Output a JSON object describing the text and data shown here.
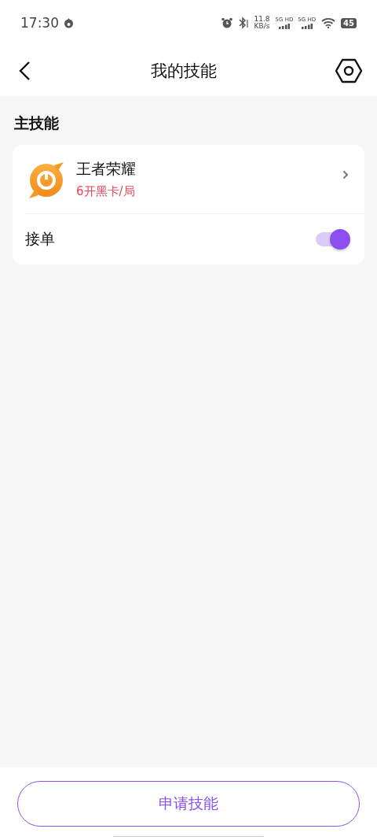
{
  "status_bar": {
    "time": "17:30",
    "speed": "11.8",
    "speed_unit": "KB/s",
    "networks": [
      "5G HD",
      "5G HD"
    ],
    "battery": "45"
  },
  "header": {
    "title": "我的技能"
  },
  "section": {
    "title": "主技能"
  },
  "skills": [
    {
      "name": "王者荣耀",
      "price": "6开黑卡/局",
      "order_label": "接单",
      "on": true
    }
  ],
  "bottom": {
    "button": "申请技能"
  }
}
